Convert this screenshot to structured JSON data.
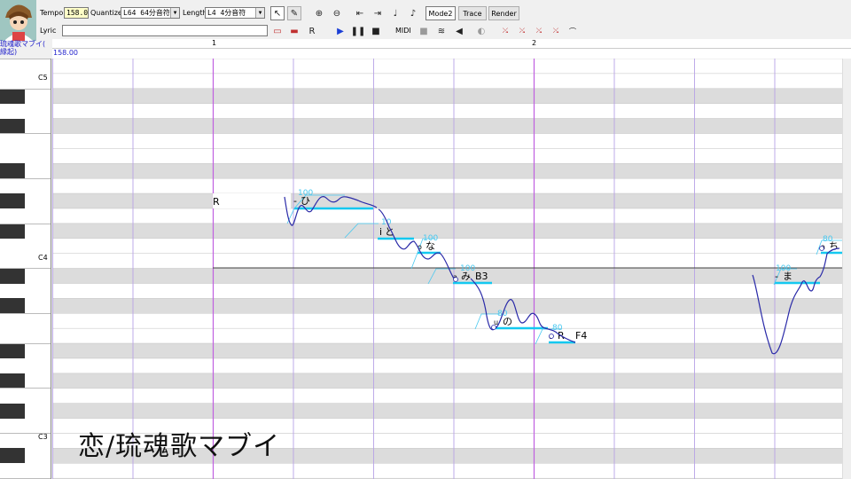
{
  "toolbar": {
    "tempo_label": "Tempo",
    "tempo_value": "158.0",
    "quantize_label": "Quantize",
    "quantize_value": "L64 64分音符",
    "length_label": "Length",
    "length_value": "L4  4分音符",
    "lyric_label": "Lyric",
    "lyric_value": "",
    "mode2_label": "Mode2",
    "trace_label": "Trace",
    "render_label": "Render",
    "midi_label": "MIDI",
    "icons": [
      "pointer-icon",
      "pencil-icon",
      "zoom-in-icon",
      "zoom-out-icon",
      "go-start-icon",
      "go-end-icon",
      "note-split-icon",
      "note-join-icon",
      "erase-icon",
      "lyric-tool-icon",
      "rest-tool-icon",
      "play-icon",
      "pause-icon",
      "stop-icon",
      "midi-record-icon",
      "midi-settings-icon",
      "speaker-icon",
      "headphone-icon",
      "pitch-tool-1-icon",
      "pitch-tool-2-icon",
      "pitch-tool-3-icon",
      "pitch-tool-4-icon",
      "pitch-tool-5-icon"
    ]
  },
  "song": {
    "title_lines": [
      "琉魂歌マブイ(",
      "縁起)"
    ],
    "tempo_marker": "158.00",
    "measures": [
      "1",
      "2"
    ]
  },
  "piano": {
    "octave_labels": [
      "C5",
      "C4",
      "C3"
    ]
  },
  "notes": [
    {
      "lyric": "R",
      "velocity": ""
    },
    {
      "lyric": "ひ",
      "prefix": "-",
      "velocity": "100"
    },
    {
      "lyric": "と",
      "prefix": "i",
      "velocity": "10"
    },
    {
      "lyric": "な",
      "prefix": "o",
      "velocity": "100"
    },
    {
      "lyric": "み",
      "prefix": "a",
      "velocity": "100",
      "suffix": "B3"
    },
    {
      "lyric": "の",
      "prefix": "u",
      "velocity": "80"
    },
    {
      "lyric": "R",
      "prefix": "o",
      "velocity": "80",
      "suffix": "F4"
    },
    {
      "lyric": "ま",
      "prefix": "-",
      "velocity": "100"
    },
    {
      "lyric": "ち",
      "prefix": "a",
      "velocity": "80"
    }
  ],
  "watermark": "恋/琉魂歌マブイ",
  "colors": {
    "row_gray": "#dcdcdc",
    "beat_line": "#b7a2e6",
    "measure_line": "#c060e0",
    "note_bar": "#14c8f0",
    "pitch_curve": "#2a2aa8",
    "velocity_text": "#46c8f0"
  }
}
